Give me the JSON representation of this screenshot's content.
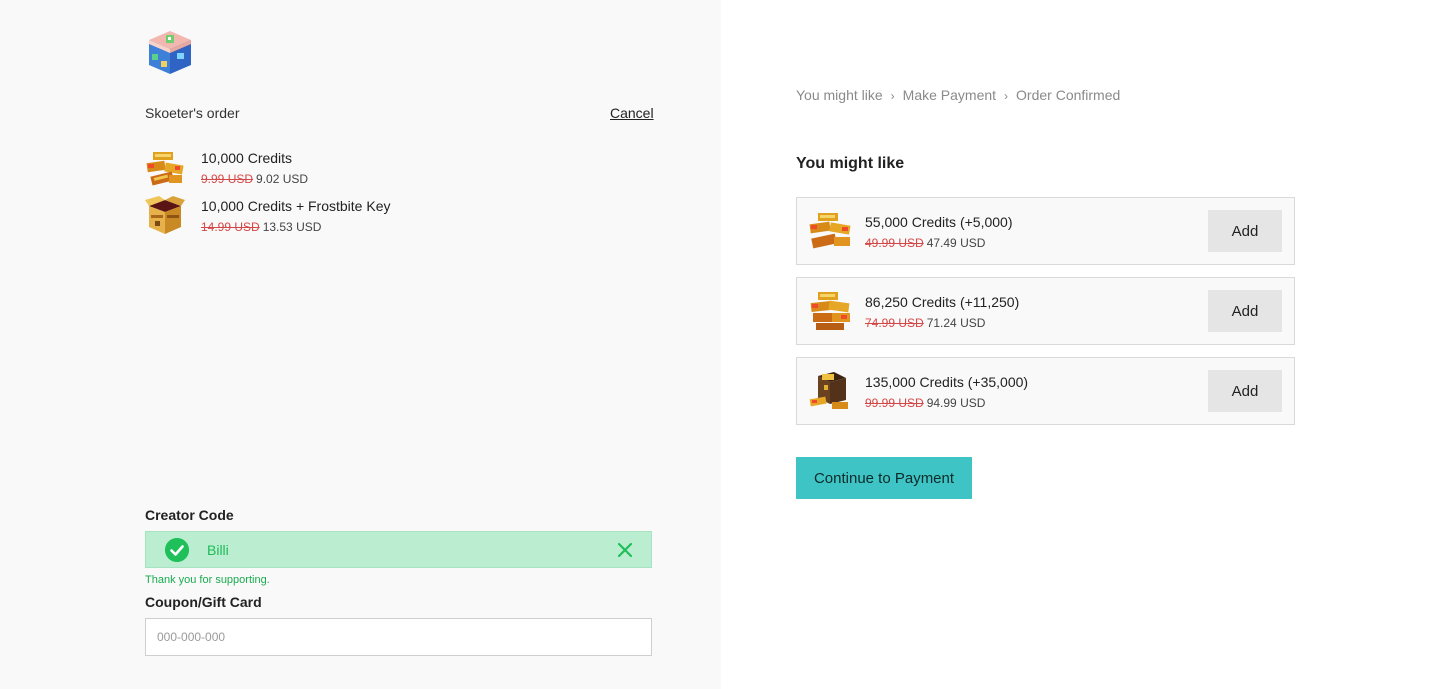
{
  "order": {
    "title": "Skoeter's order",
    "cancel_label": "Cancel",
    "items": [
      {
        "name": "10,000 Credits",
        "old_price": "9.99 USD",
        "price": "9.02 USD",
        "icon": "credits-pile-icon"
      },
      {
        "name": "10,000 Credits + Frostbite Key",
        "old_price": "14.99 USD",
        "price": "13.53 USD",
        "icon": "open-crate-icon"
      }
    ]
  },
  "creator": {
    "label": "Creator Code",
    "code": "Billi",
    "message": "Thank you for supporting."
  },
  "coupon": {
    "label": "Coupon/Gift Card",
    "placeholder": "000-000-000"
  },
  "breadcrumb": [
    "You might like",
    "Make Payment",
    "Order Confirmed"
  ],
  "recommendations": {
    "title": "You might like",
    "items": [
      {
        "name": "55,000 Credits (+5,000)",
        "old_price": "49.99 USD",
        "price": "47.49 USD",
        "add_label": "Add"
      },
      {
        "name": "86,250 Credits (+11,250)",
        "old_price": "74.99 USD",
        "price": "71.24 USD",
        "add_label": "Add"
      },
      {
        "name": "135,000 Credits (+35,000)",
        "old_price": "99.99 USD",
        "price": "94.99 USD",
        "add_label": "Add"
      }
    ]
  },
  "continue_label": "Continue to Payment",
  "colors": {
    "accent": "#3ec4c4",
    "success": "#1fbf5a",
    "strike_price": "#d54848"
  }
}
